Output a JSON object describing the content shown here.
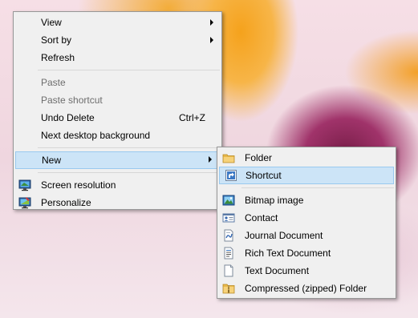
{
  "main_menu": {
    "view": "View",
    "sort_by": "Sort by",
    "refresh": "Refresh",
    "paste": "Paste",
    "paste_shortcut": "Paste shortcut",
    "undo_delete": "Undo Delete",
    "undo_delete_shortcut": "Ctrl+Z",
    "next_desktop_background": "Next desktop background",
    "new": "New",
    "screen_resolution": "Screen resolution",
    "personalize": "Personalize"
  },
  "new_submenu": {
    "folder": "Folder",
    "shortcut": "Shortcut",
    "bitmap_image": "Bitmap image",
    "contact": "Contact",
    "journal_document": "Journal Document",
    "rich_text_document": "Rich Text Document",
    "text_document": "Text Document",
    "compressed_folder": "Compressed (zipped) Folder"
  },
  "icons": {
    "screen_resolution": "monitor-icon",
    "personalize": "monitor-paint-icon",
    "folder": "folder-icon",
    "shortcut": "shortcut-icon",
    "bitmap_image": "bitmap-image-icon",
    "contact": "contact-card-icon",
    "journal_document": "journal-document-icon",
    "rich_text_document": "rich-text-document-icon",
    "text_document": "text-document-icon",
    "compressed_folder": "zip-folder-icon"
  },
  "colors": {
    "menu_background": "#f0f0f0",
    "highlight_background": "#cce4f7",
    "highlight_border": "#99c9ef",
    "disabled_text": "#6d6d6d"
  }
}
